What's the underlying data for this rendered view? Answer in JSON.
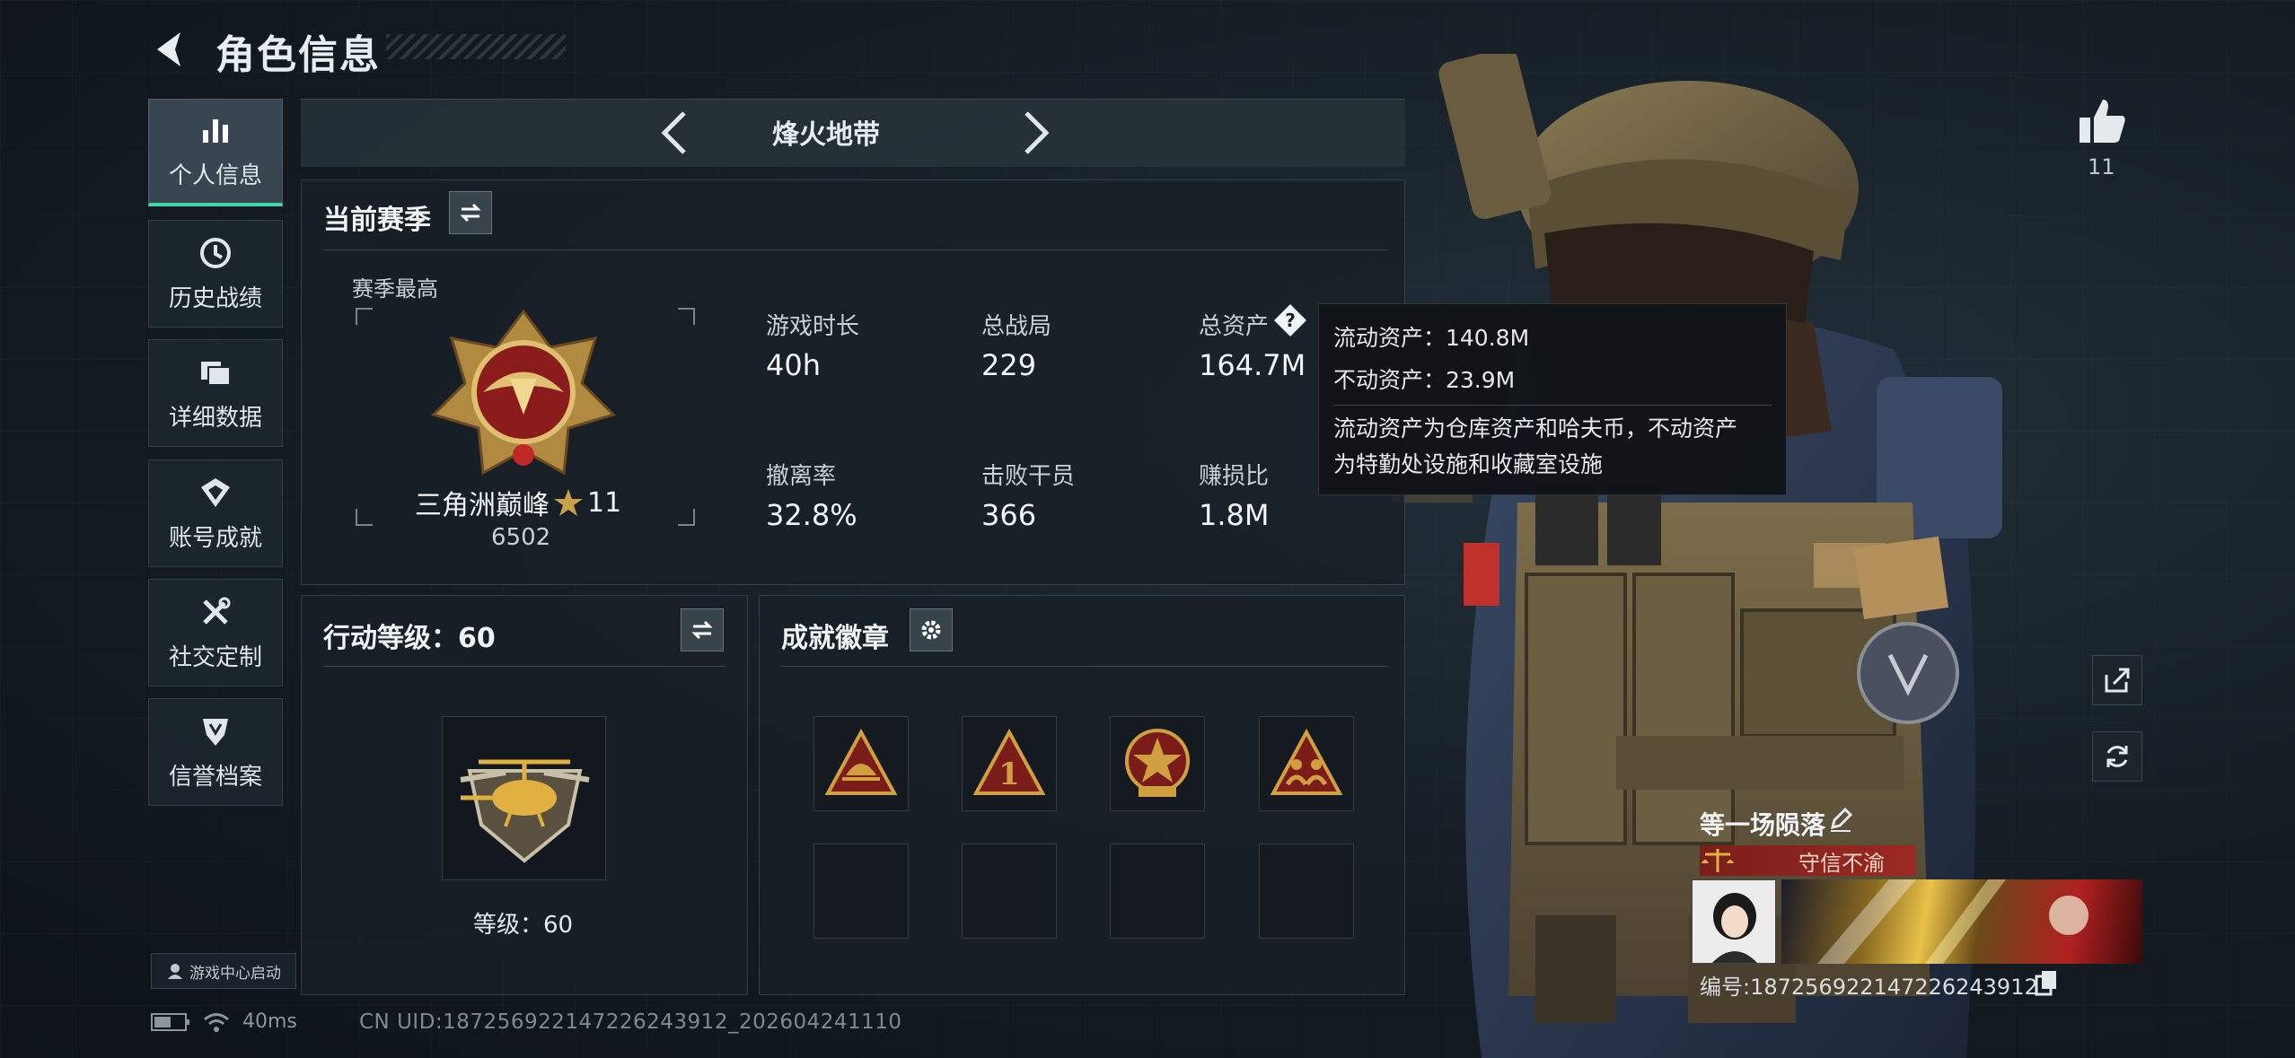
{
  "header": {
    "title": "角色信息"
  },
  "nav": [
    {
      "label": "个人信息",
      "icon": "bar-chart-icon",
      "active": true
    },
    {
      "label": "历史战绩",
      "icon": "clock-icon",
      "active": false
    },
    {
      "label": "详细数据",
      "icon": "folder-icon",
      "active": false
    },
    {
      "label": "账号成就",
      "icon": "achievement-icon",
      "active": false
    },
    {
      "label": "社交定制",
      "icon": "tools-icon",
      "active": false
    },
    {
      "label": "信誉档案",
      "icon": "shield-icon",
      "active": false
    }
  ],
  "game_center": "游戏中心启动",
  "status": {
    "ping": "40ms",
    "uid": "CN UID:187256922147226243912_202604241110"
  },
  "mode": {
    "label": "烽火地带"
  },
  "season": {
    "title": "当前赛季",
    "best_label": "赛季最高",
    "rank_name": "三角洲巅峰",
    "rank_stars": "11",
    "rank_score": "6502",
    "stats": [
      {
        "label": "游戏时长",
        "value": "40h"
      },
      {
        "label": "总战局",
        "value": "229"
      },
      {
        "label": "总资产",
        "value": "164.7M"
      },
      {
        "label": "撤离率",
        "value": "32.8%"
      },
      {
        "label": "击败干员",
        "value": "366"
      },
      {
        "label": "赚损比",
        "value": "1.8M"
      }
    ]
  },
  "tooltip": {
    "line1": "流动资产：140.8M",
    "line2": "不动资产：23.9M",
    "desc1": "流动资产为仓库资产和哈夫币，不动资产",
    "desc2": "为特勤处设施和收藏室设施"
  },
  "action_level": {
    "title": "行动等级：60",
    "level_text": "等级：60"
  },
  "badges": {
    "title": "成就徽章"
  },
  "likes": {
    "count": "11"
  },
  "player": {
    "name": "等一场陨落",
    "title": "守信不渝",
    "id": "编号:187256922147226243912"
  },
  "colors": {
    "accent": "#3fd8a6",
    "title_red": "#9b2a22",
    "gold": "#c9a04a"
  }
}
